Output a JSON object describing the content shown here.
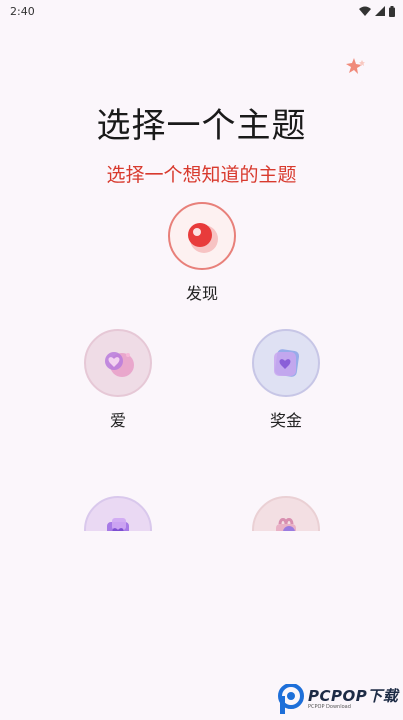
{
  "status_bar": {
    "time": "2:40"
  },
  "header": {
    "title": "选择一个主题",
    "subtitle": "选择一个想知道的主题"
  },
  "topics": [
    {
      "label": "发现",
      "icon": "red-record-icon",
      "selected": true
    },
    {
      "label": "爱",
      "icon": "heart-bubble-icon"
    },
    {
      "label": "奖金",
      "icon": "bonus-heart-card-icon"
    },
    {
      "label": "",
      "icon": "purple-gift-icon"
    },
    {
      "label": "",
      "icon": "pink-gift-icon"
    }
  ],
  "watermark": {
    "brand": "PCPOP下载",
    "sub": "PCPOP Download"
  },
  "colors": {
    "accent_red": "#d83a2e",
    "background": "#fbf6fb"
  }
}
